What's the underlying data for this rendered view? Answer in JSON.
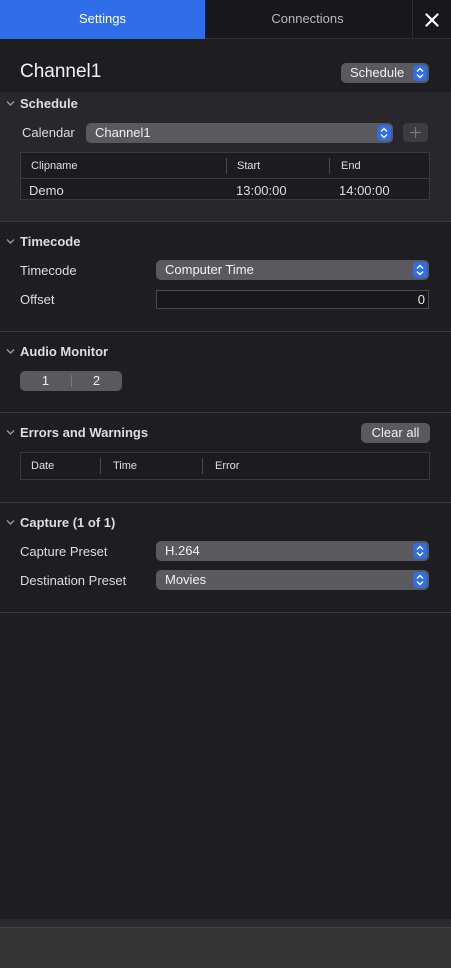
{
  "tabs": [
    {
      "label": "Settings",
      "active": true
    },
    {
      "label": "Connections",
      "active": false
    }
  ],
  "header": {
    "channel_title": "Channel1",
    "mode_value": "Schedule"
  },
  "schedule": {
    "section_title": "Schedule",
    "calendar_label": "Calendar",
    "calendar_value": "Channel1",
    "columns": [
      "Clipname",
      "Start",
      "End"
    ],
    "rows": [
      {
        "clipname": "Demo",
        "start": "13:00:00",
        "end": "14:00:00"
      }
    ]
  },
  "timecode": {
    "section_title": "Timecode",
    "timecode_label": "Timecode",
    "timecode_value": "Computer Time",
    "offset_label": "Offset",
    "offset_value": "0"
  },
  "audio_monitor": {
    "section_title": "Audio Monitor",
    "segments": [
      "1",
      "2"
    ]
  },
  "errors": {
    "section_title": "Errors and Warnings",
    "clear_label": "Clear all",
    "columns": [
      "Date",
      "Time",
      "Error"
    ]
  },
  "capture": {
    "section_title": "Capture (1 of 1)",
    "capture_preset_label": "Capture Preset",
    "capture_preset_value": "H.264",
    "destination_preset_label": "Destination Preset",
    "destination_preset_value": "Movies"
  },
  "colors": {
    "accent": "#2f6ee8",
    "panel_bg": "#1e1d22",
    "section_bg": "#28272d"
  }
}
